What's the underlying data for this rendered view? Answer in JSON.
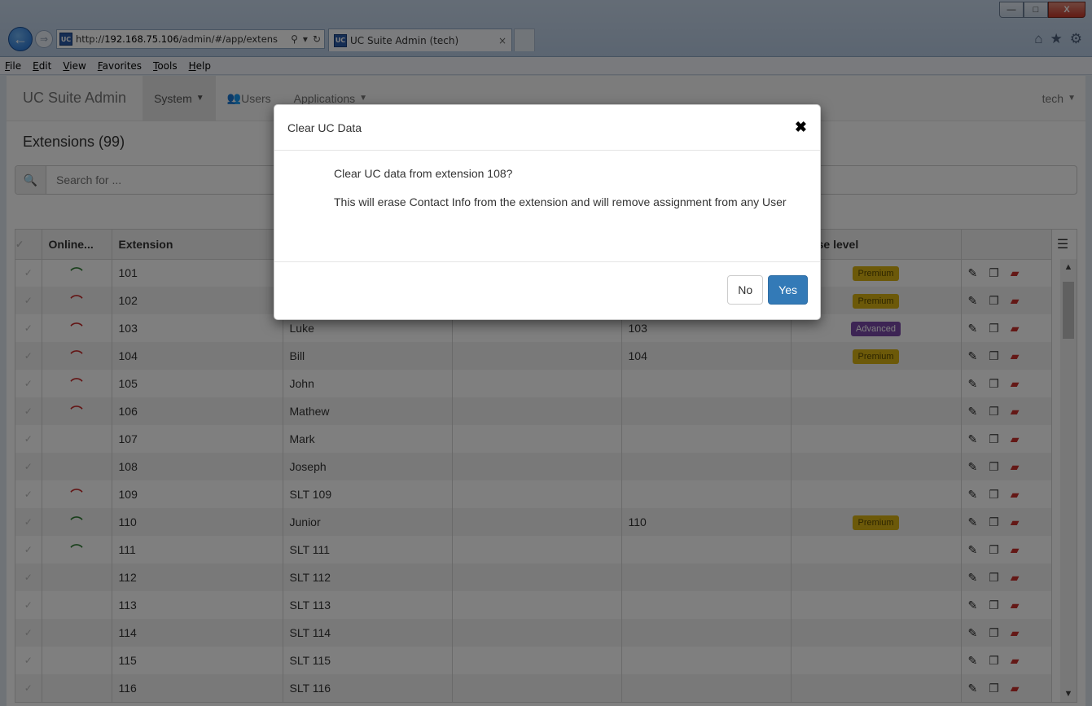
{
  "window": {
    "controls": {
      "minimize": "—",
      "maximize": "□",
      "close": "X"
    }
  },
  "browser": {
    "favicon": "UC",
    "url_prefix": "http://",
    "url_host": "192.168.75.106",
    "url_path": "/admin/#/app/extens",
    "tab_title": "UC Suite Admin (tech)",
    "tab_close": "×",
    "addr_search": "⚲",
    "addr_dropdown": "▾",
    "addr_refresh": "↻",
    "icons": [
      "home-icon",
      "favorites-star-icon",
      "tools-gear-icon"
    ],
    "menu": [
      "File",
      "Edit",
      "View",
      "Favorites",
      "Tools",
      "Help"
    ]
  },
  "app": {
    "brand": "UC Suite Admin",
    "nav": [
      {
        "label": "System",
        "dropdown": true,
        "active": true
      },
      {
        "label": "Users",
        "icon": "users-icon",
        "dropdown": false
      },
      {
        "label": "Applications",
        "dropdown": true
      }
    ],
    "user": "tech"
  },
  "page": {
    "title": "Extensions (99)",
    "search_placeholder": "Search for ..."
  },
  "table": {
    "columns": [
      "",
      "Online...",
      "Extension",
      "",
      "",
      "",
      "cense level",
      ""
    ],
    "rows": [
      {
        "ext": "101",
        "name": "",
        "num": "",
        "status": "green",
        "license": "Premium"
      },
      {
        "ext": "102",
        "name": "",
        "num": "",
        "status": "red",
        "license": "Premium"
      },
      {
        "ext": "103",
        "name": "Luke",
        "num": "103",
        "status": "red",
        "license": "Advanced"
      },
      {
        "ext": "104",
        "name": "Bill",
        "num": "104",
        "status": "red",
        "license": "Premium"
      },
      {
        "ext": "105",
        "name": "John",
        "num": "",
        "status": "red",
        "license": ""
      },
      {
        "ext": "106",
        "name": "Mathew",
        "num": "",
        "status": "red",
        "license": ""
      },
      {
        "ext": "107",
        "name": "Mark",
        "num": "",
        "status": "",
        "license": ""
      },
      {
        "ext": "108",
        "name": "Joseph",
        "num": "",
        "status": "",
        "license": ""
      },
      {
        "ext": "109",
        "name": "SLT 109",
        "num": "",
        "status": "red",
        "license": ""
      },
      {
        "ext": "110",
        "name": "Junior",
        "num": "110",
        "status": "green",
        "license": "Premium"
      },
      {
        "ext": "111",
        "name": "SLT 111",
        "num": "",
        "status": "green",
        "license": ""
      },
      {
        "ext": "112",
        "name": "SLT 112",
        "num": "",
        "status": "",
        "license": ""
      },
      {
        "ext": "113",
        "name": "SLT 113",
        "num": "",
        "status": "",
        "license": ""
      },
      {
        "ext": "114",
        "name": "SLT 114",
        "num": "",
        "status": "",
        "license": ""
      },
      {
        "ext": "115",
        "name": "SLT 115",
        "num": "",
        "status": "",
        "license": ""
      },
      {
        "ext": "116",
        "name": "SLT 116",
        "num": "",
        "status": "",
        "license": ""
      }
    ]
  },
  "modal": {
    "title": "Clear UC Data",
    "close": "✖",
    "message": "Clear UC data from extension 108?",
    "detail": "This will erase Contact Info from the extension and will remove assignment from any User",
    "no_label": "No",
    "yes_label": "Yes"
  }
}
